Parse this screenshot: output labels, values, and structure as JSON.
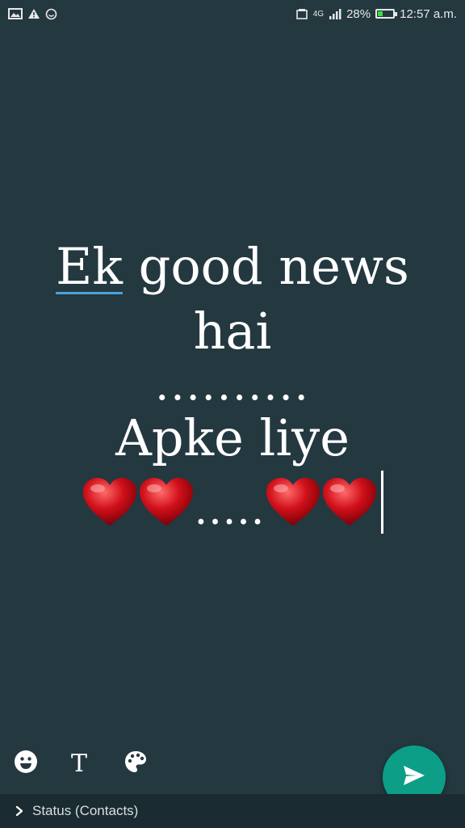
{
  "status_bar": {
    "left_icons": [
      "image-icon",
      "warning-icon",
      "smiley-status-icon"
    ],
    "network": "4G",
    "battery": "28%",
    "battery_level": 0.28,
    "time": "12:57 a.m."
  },
  "editor": {
    "line1_word1": "Ek",
    "line1_rest": " good news",
    "line2": "hai",
    "line3": "..........",
    "line4": "Apke liye",
    "line5_dots": ".....",
    "hearts_icon": "red-heart-icon"
  },
  "toolbar": {
    "emoji_icon": "emoji-icon",
    "text_label": "T",
    "palette_icon": "palette-icon"
  },
  "send_button": {
    "icon": "send-icon",
    "color": "#0d9e88"
  },
  "bottom_bar": {
    "label": "Status (Contacts)"
  },
  "colors": {
    "background": "#243840",
    "accent": "#0d9e88",
    "underline": "#4aa3df"
  }
}
